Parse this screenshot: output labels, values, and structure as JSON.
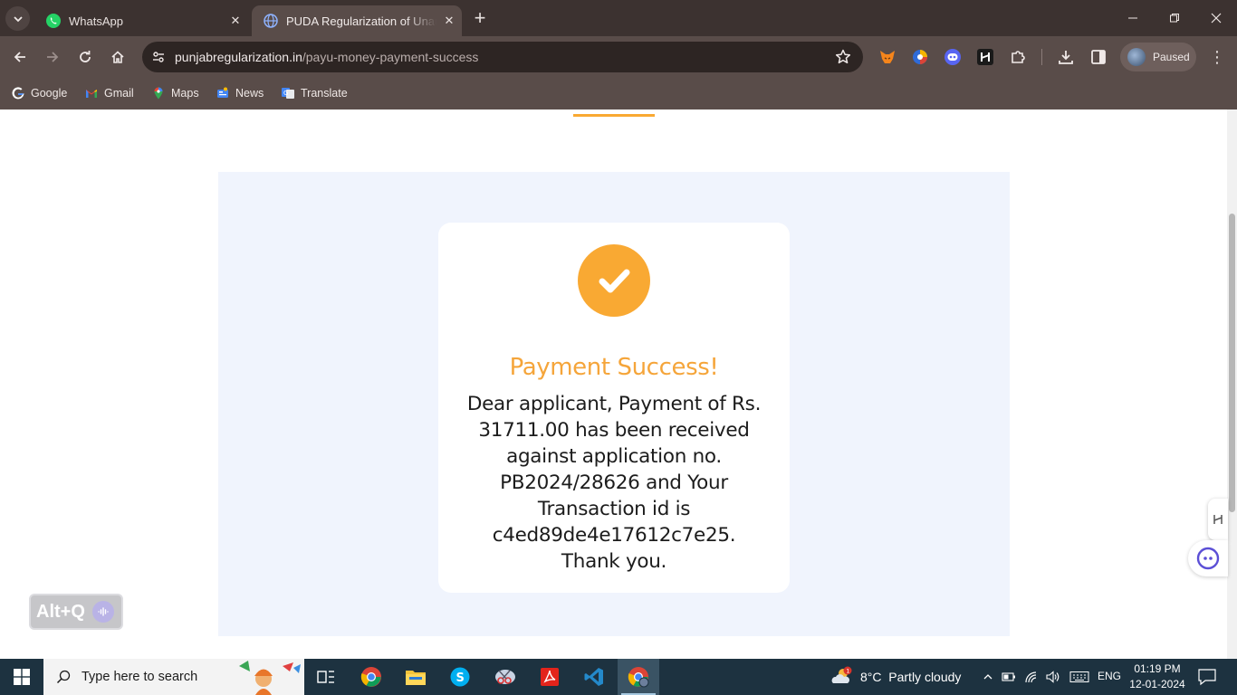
{
  "browser": {
    "tabs": [
      {
        "title": "WhatsApp",
        "active": false
      },
      {
        "title": "PUDA Regularization of Unauthorized",
        "active": true
      }
    ],
    "url_host": "punjabregularization.in",
    "url_path": "/payu-money-payment-success",
    "profile_label": "Paused",
    "bookmarks": [
      "Google",
      "Gmail",
      "Maps",
      "News",
      "Translate"
    ]
  },
  "page": {
    "success_title": "Payment Success!",
    "message": "Dear applicant, Payment of Rs. 31711.00 has been received against application no. PB2024/28626 and Your Transaction id is c4ed89de4e17612c7e25. Thank you.",
    "accent_color": "#f9a933",
    "panel_color": "#f0f4fd"
  },
  "overlay": {
    "shortcut_label": "Alt+Q"
  },
  "taskbar": {
    "search_placeholder": "Type here to search",
    "weather": "8°C  Partly cloudy",
    "weather_badge": "1",
    "language": "ENG",
    "time": "01:19 PM",
    "date": "12-01-2024"
  }
}
